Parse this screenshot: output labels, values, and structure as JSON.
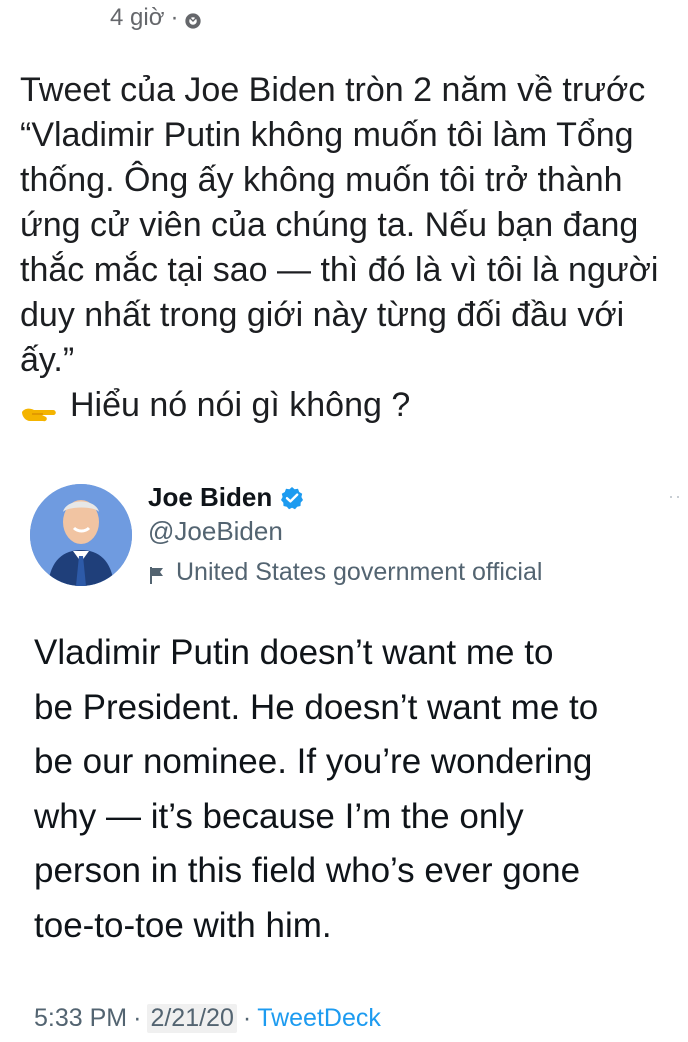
{
  "post": {
    "time": "4 giờ",
    "separator": "·",
    "visibility_icon": "globe-icon",
    "caption_lines": [
      "Tweet của Joe Biden tròn 2 năm về trước",
      "“Vladimir Putin không muốn tôi làm Tổng",
      "thống.  Ông ấy không muốn tôi trở thành",
      "ứng cử viên của chúng ta. Nếu bạn đang",
      "thắc mắc tại sao — thì đó là vì tôi là người",
      "duy nhất trong giới này từng đối đầu với",
      "ấy.”"
    ],
    "point_icon": "pointing-hand-icon",
    "point_text": "Hiểu nó nói gì không ?"
  },
  "tweet": {
    "author_name": "Joe Biden",
    "handle": "@JoeBiden",
    "verified_icon": "verified-badge-icon",
    "label_icon": "flag-icon",
    "label_text": "United States government official",
    "text_lines": [
      "Vladimir Putin doesn’t want me to",
      "be President. He doesn’t want me to",
      "be our nominee. If you’re wondering",
      "why — it’s because I’m the only",
      "person in this field who’s ever gone",
      "toe-to-toe with him."
    ],
    "time": "5:33 PM",
    "date": "2/21/20",
    "source": "TweetDeck",
    "separator": "·",
    "more": "··"
  },
  "colors": {
    "text": "#1c1e21",
    "muted": "#65676b",
    "tweet_text": "#0f1419",
    "twitter_blue": "#1d9bf0",
    "twitter_gray": "#536471",
    "emoji_yellow": "#f4b400"
  }
}
